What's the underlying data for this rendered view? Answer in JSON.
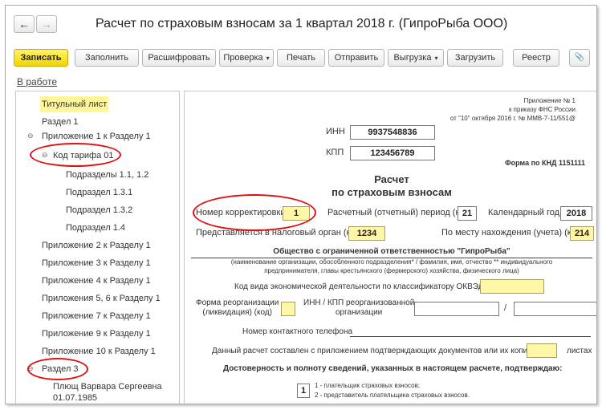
{
  "window": {
    "title": "Расчет по страховым взносам за 1 квартал 2018 г. (ГипроРыба ООО)"
  },
  "nav": {
    "back": "←",
    "forward": "→"
  },
  "toolbar": {
    "save": "Записать",
    "fill": "Заполнить",
    "decode": "Расшифровать",
    "check": "Проверка",
    "print": "Печать",
    "send": "Отправить",
    "export": "Выгрузка",
    "load": "Загрузить",
    "registry": "Реестр",
    "dropdown_caret": "▾",
    "attach_icon": "📎"
  },
  "status_link": "В работе",
  "sidebar": {
    "expand_glyph": "⊖",
    "items": [
      "Титульный лист",
      "Раздел 1",
      "Приложение 1 к Разделу 1",
      "Код тарифа 01",
      "Подразделы 1.1, 1.2",
      "Подраздел 1.3.1",
      "Подраздел 1.3.2",
      "Подраздел 1.4",
      "Приложение 2 к Разделу 1",
      "Приложение 3 к Разделу 1",
      "Приложение 4 к Разделу 1",
      "Приложения 5, 6 к Разделу 1",
      "Приложение 7 к Разделу 1",
      "Приложение 9 к Разделу 1",
      "Приложение 10 к Разделу 1",
      "Раздел 3",
      "Плющ Варвара Сергеевна",
      "01.07.1985"
    ]
  },
  "form": {
    "appendix": [
      "Приложение № 1",
      "к приказу ФНС России",
      "от \"10\" октября 2016 г. № ММВ-7-11/551@"
    ],
    "inn_label": "ИНН",
    "inn": "9937548836",
    "kpp_label": "КПП",
    "kpp": "123456789",
    "knd": "Форма по КНД 1151111",
    "heading1": "Расчет",
    "heading2": "по страховым взносам",
    "correction_label": "Номер корректировки",
    "correction": "1",
    "period_label": "Расчетный (отчетный) период (код)",
    "period": "21",
    "year_label": "Календарный год",
    "year": "2018",
    "tax_organ_label": "Представляется в налоговый орган (код)",
    "tax_organ": "1234",
    "location_label": "По месту нахождения (учета) (код)",
    "location": "214",
    "org_name": "Общество с ограниченной ответственностью \"ГипроРыба\"",
    "org_note1": "(наименование организации, обособленного подразделения* / фамилия, имя, отчество ** индивидуального",
    "org_note2": "предпринимателя, главы крестьянского (фермерского) хозяйства, физического лица)",
    "okved_label": "Код вида экономической деятельности по классификатору ОКВЭД2",
    "reorg_label1": "Форма реорганизации",
    "reorg_label2": "(ликвидация) (код)",
    "reorg_inn_label1": "ИНН / КПП реорганизованной",
    "reorg_inn_label2": "организации",
    "slash": "/",
    "phone_label": "Номер контактного телефона",
    "attached_label": "Данный расчет составлен с приложением подтверждающих документов или их копий на",
    "sheets_label": "листах",
    "confirm_heading": "Достоверность и полноту сведений, указанных в настоящем расчете, подтверждаю:",
    "signer_code": "1",
    "signer_opt1": "1 - плательщик страховых взносов;",
    "signer_opt2": "2 - представитель плательщика страховых взносов."
  }
}
